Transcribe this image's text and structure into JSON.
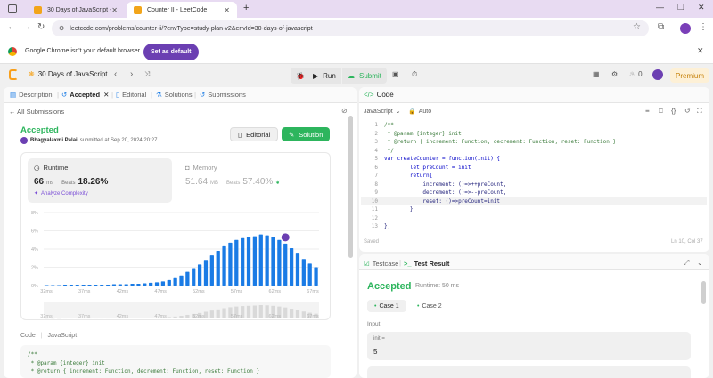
{
  "browser": {
    "tabs": [
      {
        "title": "30 Days of JavaScript - Study P",
        "active": false
      },
      {
        "title": "Counter II - LeetCode",
        "active": true
      }
    ],
    "url": "leetcode.com/problems/counter-ii/?envType=study-plan-v2&envId=30-days-of-javascript",
    "default_notice": "Google Chrome isn't your default browser",
    "set_default_label": "Set as default"
  },
  "topnav": {
    "study_plan": "30 Days of JavaScript",
    "run_label": "Run",
    "submit_label": "Submit",
    "streak_count": "0",
    "premium_label": "Premium"
  },
  "left": {
    "tabs": [
      {
        "label": "Description"
      },
      {
        "label": "Accepted"
      },
      {
        "label": "Editorial"
      },
      {
        "label": "Solutions"
      },
      {
        "label": "Submissions"
      }
    ],
    "all_submissions": "All Submissions",
    "status": "Accepted",
    "user": "Bhagyalaxmi Palai",
    "submitted_text": "submitted at Sep 20, 2024 20:27",
    "editorial_btn": "Editorial",
    "solution_btn": "Solution",
    "runtime": {
      "label": "Runtime",
      "value": "66",
      "unit": "ms",
      "beats_label": "Beats",
      "beats_value": "18.26%",
      "analyze": "Analyze Complexity"
    },
    "memory": {
      "label": "Memory",
      "value": "51.64",
      "unit": "MB",
      "beats_label": "Beats",
      "beats_value": "57.40%"
    },
    "code_header": {
      "label": "Code",
      "lang": "JavaScript"
    },
    "code_preview": [
      "/**",
      " * @param {integer} init",
      " * @return { increment: Function, decrement: Function, reset: Function }"
    ]
  },
  "chart_data": {
    "type": "bar",
    "ylabels": [
      "8%",
      "6%",
      "4%",
      "2%",
      "0%"
    ],
    "xlabels": [
      "32ms",
      "37ms",
      "42ms",
      "47ms",
      "52ms",
      "57ms",
      "62ms",
      "67ms"
    ],
    "ylim": [
      0,
      8
    ],
    "values": [
      0.05,
      0.05,
      0.05,
      0.1,
      0.1,
      0.1,
      0.1,
      0.1,
      0.1,
      0.1,
      0.1,
      0.15,
      0.15,
      0.15,
      0.2,
      0.2,
      0.25,
      0.3,
      0.35,
      0.45,
      0.6,
      0.8,
      1.1,
      1.5,
      1.9,
      2.3,
      2.8,
      3.3,
      3.8,
      4.3,
      4.7,
      5.0,
      5.2,
      5.3,
      5.4,
      5.6,
      5.5,
      5.3,
      5.0,
      4.6,
      4.1,
      3.5,
      2.9,
      2.4,
      2.0
    ],
    "highlight_index": 39
  },
  "code": {
    "title": "Code",
    "language": "JavaScript",
    "mode": "Auto",
    "saved": "Saved",
    "cursor": "Ln 10, Col 37",
    "lines": [
      "/**",
      " * @param {integer} init",
      " * @return { increment: Function, decrement: Function, reset: Function }",
      " */",
      "var createCounter = function(init) {",
      "        let preCount = init",
      "        return{",
      "            increment: ()=>++preCount,",
      "            decrement: ()=>--preCount,",
      "            reset: ()=>preCount=init",
      "        }",
      "",
      "};"
    ]
  },
  "testpanel": {
    "testcase_tab": "Testcase",
    "result_tab": "Test Result",
    "status": "Accepted",
    "runtime_text": "Runtime: 50 ms",
    "cases": [
      "Case 1",
      "Case 2"
    ],
    "input_label": "Input",
    "var_label": "init =",
    "var_value": "5"
  }
}
